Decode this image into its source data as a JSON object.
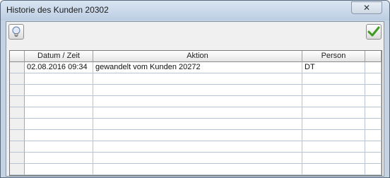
{
  "window": {
    "title": "Historie des Kunden 20302",
    "close_glyph": "✕"
  },
  "toolbar": {
    "info_icon": "lightbulb-icon",
    "ok_icon": "checkmark-icon"
  },
  "table": {
    "headers": [
      "",
      "Datum / Zeit",
      "Aktion",
      "Person",
      ""
    ],
    "rows": [
      {
        "datetime": "02.08.2016 09:34",
        "action": "gewandelt vom Kunden 20272",
        "person": "DT"
      }
    ]
  },
  "colors": {
    "check": "#3f9a1f",
    "selected_row": "#ffffff",
    "grid_line": "#b9c3d1"
  }
}
